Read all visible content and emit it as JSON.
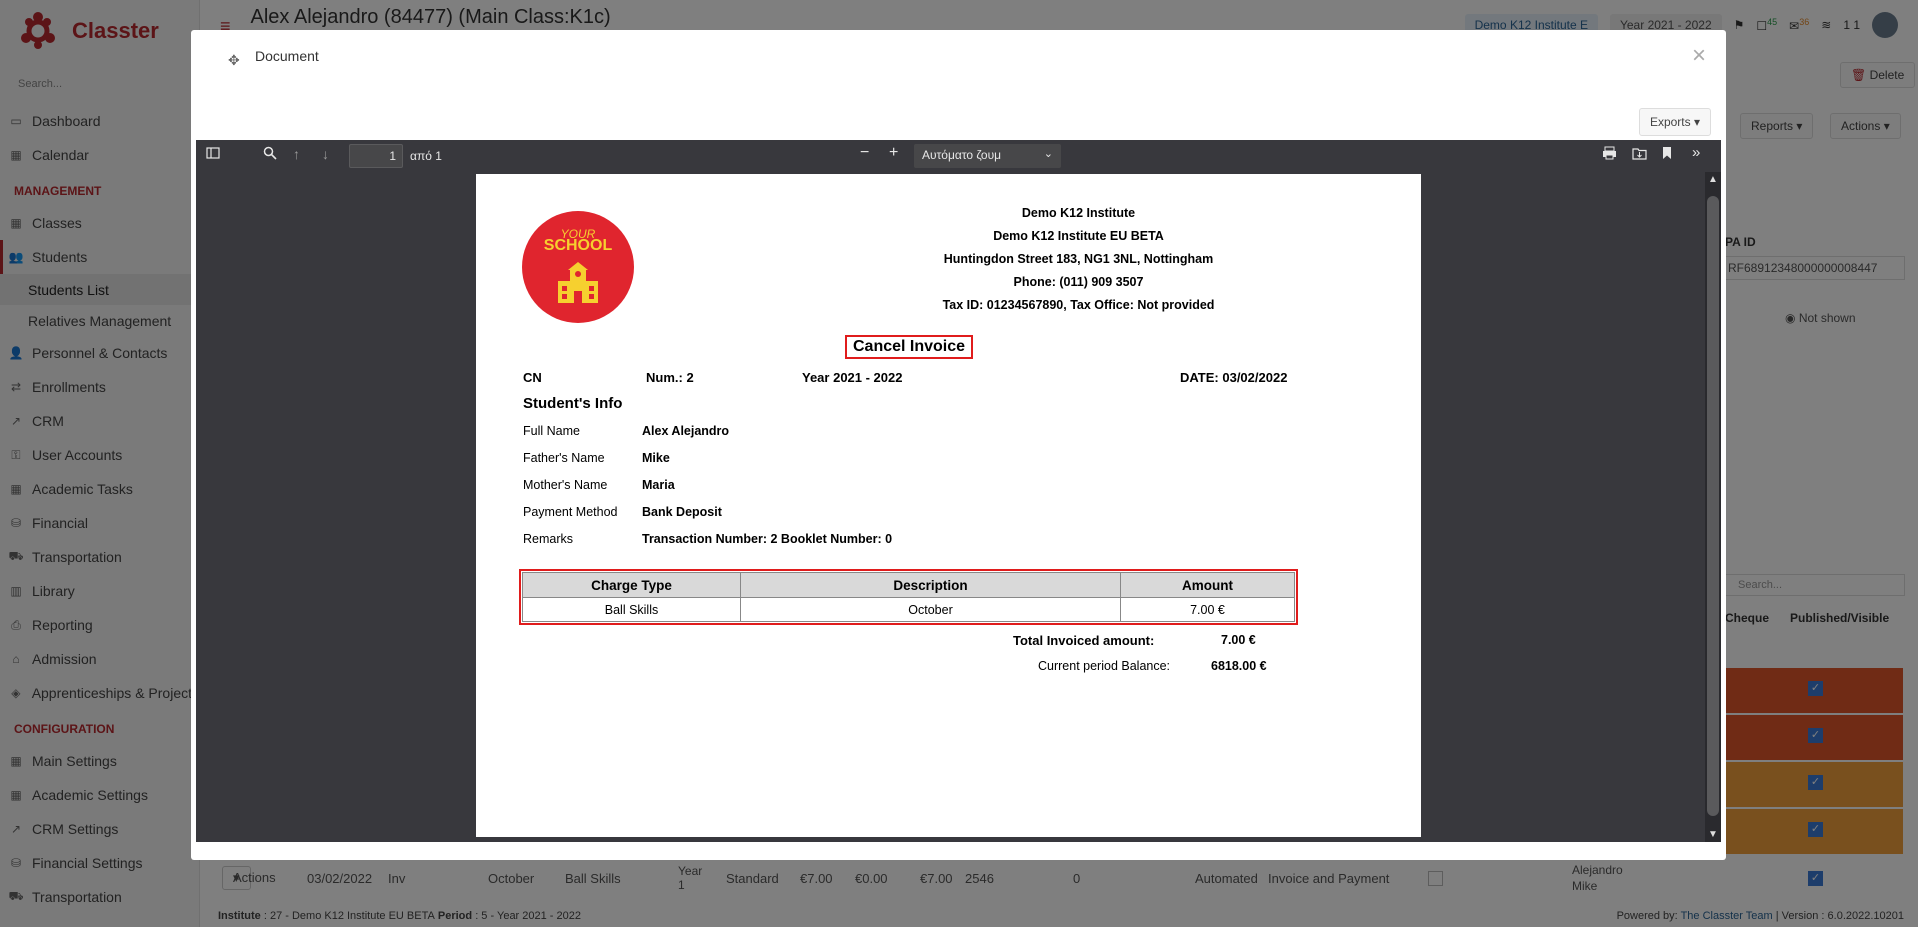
{
  "app": {
    "name": "Classter",
    "page_title": "Alex Alejandro (84477) (Main Class:K1c)",
    "search_placeholder": "Search..."
  },
  "header": {
    "institute_pill": "Demo K12 Institute E",
    "year_pill": "Year 2021 - 2022",
    "badge_45": "45",
    "badge_36": "36",
    "user_count": "1 1"
  },
  "sidebar": {
    "items_top": [
      {
        "label": "Dashboard",
        "icon": "monitor-icon"
      },
      {
        "label": "Calendar",
        "icon": "calendar-icon"
      }
    ],
    "section_management": "MANAGEMENT",
    "items_management": [
      {
        "label": "Classes",
        "icon": "grid-icon"
      },
      {
        "label": "Students",
        "icon": "users-icon"
      }
    ],
    "sub_students": [
      "Students List",
      "Relatives Management"
    ],
    "items_after": [
      {
        "label": "Personnel & Contacts",
        "icon": "person-icon"
      },
      {
        "label": "Enrollments",
        "icon": "swap-icon"
      },
      {
        "label": "CRM",
        "icon": "chart-icon"
      },
      {
        "label": "User Accounts",
        "icon": "key-icon"
      },
      {
        "label": "Academic Tasks",
        "icon": "tiles-icon"
      },
      {
        "label": "Financial",
        "icon": "coins-icon"
      },
      {
        "label": "Transportation",
        "icon": "bus-icon"
      },
      {
        "label": "Library",
        "icon": "books-icon"
      },
      {
        "label": "Reporting",
        "icon": "printer-icon"
      },
      {
        "label": "Admission",
        "icon": "bank-icon"
      },
      {
        "label": "Apprenticeships & Projects",
        "icon": "cube-icon"
      }
    ],
    "section_config": "CONFIGURATION",
    "items_config": [
      {
        "label": "Main Settings",
        "icon": "grid-icon"
      },
      {
        "label": "Academic Settings",
        "icon": "grid-icon"
      },
      {
        "label": "CRM Settings",
        "icon": "chart-icon"
      },
      {
        "label": "Financial Settings",
        "icon": "coins-icon"
      },
      {
        "label": "Transportation",
        "icon": "bus-icon"
      }
    ]
  },
  "background": {
    "delete_label": "Delete",
    "reports_label": "Reports",
    "actions_label": "Actions",
    "pa_id_label": "PA ID",
    "pa_id_value": "RF68912348000000008447",
    "not_shown_label": "Not shown",
    "search_placeholder": "Search...",
    "col_cheque": "Cheque",
    "col_published": "Published/Visible",
    "row": {
      "actions": "Actions",
      "date": "03/02/2022",
      "type": "Inv",
      "period": "October",
      "charge": "Ball Skills",
      "year": "Year 1",
      "plan": "Standard",
      "amount1": "€7.00",
      "amount2": "€0.00",
      "amount3": "€7.00",
      "num": "2546",
      "zero": "0",
      "mode": "Automated",
      "kind": "Invoice and Payment",
      "student": "Alejandro Mike"
    },
    "row_colors": [
      "#e0562b",
      "#e0562b",
      "#f2a03d",
      "#f2a03d"
    ]
  },
  "footer": {
    "institute_label": "Institute",
    "institute_value": ": 27 - Demo K12 Institute EU BETA",
    "period_label": "Period",
    "period_value": ": 5 - Year 2021 - 2022",
    "powered": "Powered by: ",
    "team": "The Classter Team",
    "version": "| Version : 6.0.2022.10201"
  },
  "modal": {
    "title": "Document",
    "exports_label": "Exports"
  },
  "viewer": {
    "page_number": "1",
    "page_of": "από 1",
    "zoom": "Αυτόματο ζουμ"
  },
  "invoice": {
    "logo_line1": "YOUR",
    "logo_line2": "SCHOOL",
    "institute_lines": [
      "Demo K12 Institute",
      "Demo K12 Institute EU BETA",
      "Huntingdon Street 183, NG1 3NL, Nottingham",
      "Phone: (011) 909 3507",
      "Tax ID: 01234567890, Tax Office: Not provided"
    ],
    "doc_title": "Cancel Invoice",
    "series": "CN",
    "number": "Num.: 2",
    "year": "Year 2021 - 2022",
    "date": "DATE: 03/02/2022",
    "student_info_title": "Student's Info",
    "fields": [
      {
        "label": "Full Name",
        "value": "Alex Alejandro"
      },
      {
        "label": "Father's Name",
        "value": "Mike"
      },
      {
        "label": "Mother's Name",
        "value": "Maria"
      },
      {
        "label": "Payment Method",
        "value": "Bank Deposit"
      },
      {
        "label": "Remarks",
        "value": "Transaction Number: 2 Booklet Number: 0"
      }
    ],
    "table_headers": [
      "Charge Type",
      "Description",
      "Amount"
    ],
    "table_rows": [
      [
        "Ball Skills",
        "October",
        "7.00 €"
      ]
    ],
    "total_label": "Total Invoiced amount:",
    "total_value": "7.00 €",
    "balance_label": "Current period Balance:",
    "balance_value": "6818.00 €",
    "accent_color": "#e01c1c"
  }
}
